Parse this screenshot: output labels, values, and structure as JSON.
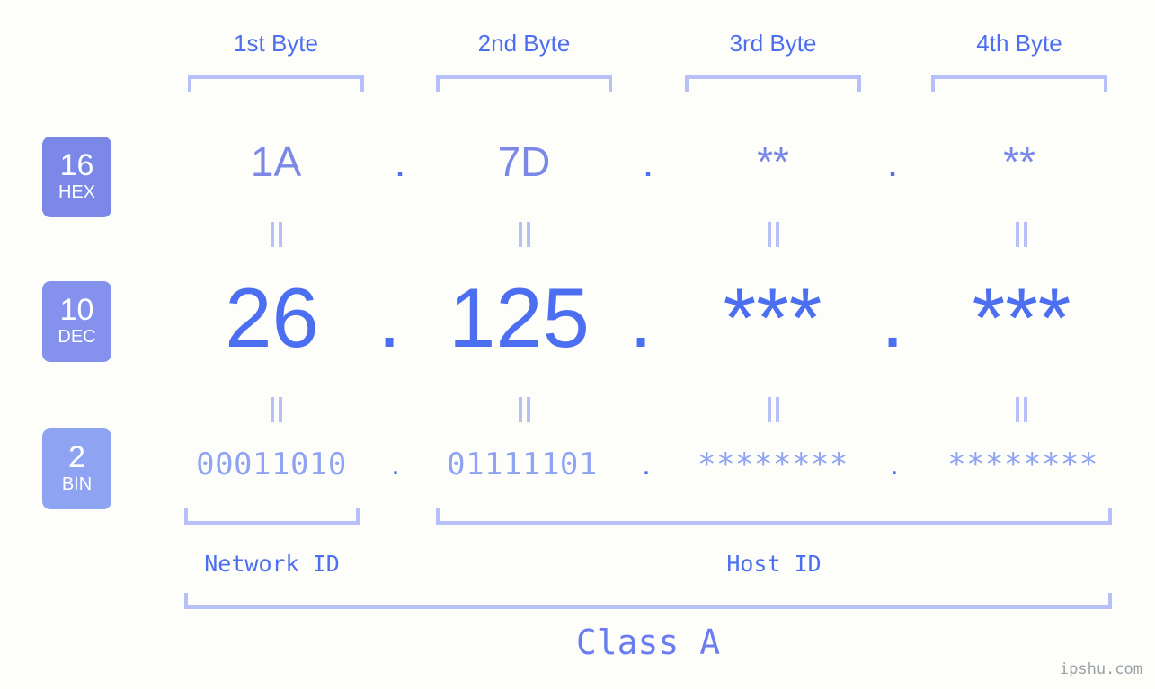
{
  "background_color": "#fdfefa",
  "accent_colors": {
    "strong_blue": "#4c6ef0",
    "mid_blue": "#7b88e8",
    "light_blue": "#8ea3f2",
    "bracket_blue": "#b7c0f7",
    "badge_hex": "#7b88e8",
    "badge_dec": "#8492ee",
    "badge_bin": "#8ea3f2",
    "watermark_gray": "#9aa0a6"
  },
  "byte_headers": [
    {
      "label": "1st Byte"
    },
    {
      "label": "2nd Byte"
    },
    {
      "label": "3rd Byte"
    },
    {
      "label": "4th Byte"
    }
  ],
  "bases": [
    {
      "number": "16",
      "name": "HEX"
    },
    {
      "number": "10",
      "name": "DEC"
    },
    {
      "number": "2",
      "name": "BIN"
    }
  ],
  "rows": {
    "hex": {
      "base_number": "16",
      "base_name": "HEX",
      "values": [
        "1A",
        "7D",
        "**",
        "**"
      ],
      "separators": [
        ".",
        ".",
        "."
      ]
    },
    "dec": {
      "base_number": "10",
      "base_name": "DEC",
      "values": [
        "26",
        "125",
        "***",
        "***"
      ],
      "separators": [
        ".",
        ".",
        "."
      ]
    },
    "bin": {
      "base_number": "2",
      "base_name": "BIN",
      "values": [
        "00011010",
        "01111101",
        "********",
        "********"
      ],
      "separators": [
        ".",
        ".",
        "."
      ]
    }
  },
  "equals_connector": "=",
  "id_sections": [
    {
      "label": "Network ID"
    },
    {
      "label": "Host ID"
    }
  ],
  "class_label": "Class A",
  "watermark": "ipshu.com"
}
